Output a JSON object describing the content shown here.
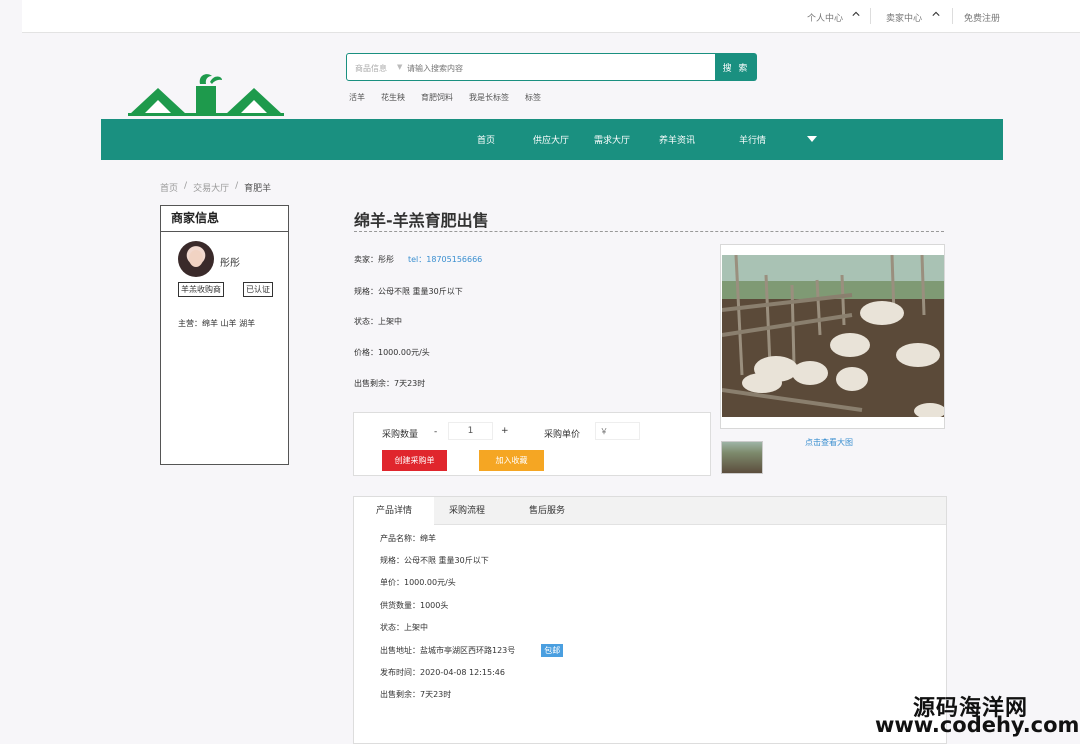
{
  "topbar": {
    "personal_center": "个人中心",
    "seller_center": "卖家中心",
    "register": "免费注册"
  },
  "search": {
    "category": "商品信息",
    "placeholder": "请输入搜索内容",
    "button": "搜 索",
    "hotwords": [
      "活羊",
      "花生秧",
      "育肥饲料",
      "我是长标签",
      "标签"
    ]
  },
  "nav": {
    "items": [
      "首页",
      "供应大厅",
      "需求大厅",
      "养羊资讯",
      "羊行情"
    ]
  },
  "breadcrumb": {
    "home": "首页",
    "sep": "/",
    "hall": "交易大厅",
    "current": "育肥羊"
  },
  "seller": {
    "header": "商家信息",
    "name": "彤彤",
    "tag1": "羊羔收购商",
    "tag2": "已认证",
    "main_business": "主营：绵羊 山羊 湖羊"
  },
  "product": {
    "title": "绵羊-羊羔育肥出售",
    "seller_label": "卖家：彤彤",
    "tel": "tel：18705156666",
    "spec": "规格：公母不限  重量30斤以下",
    "status": "状态：上架中",
    "price": "价格：1000.00元/头",
    "remaining": "出售剩余：7天23时",
    "view_big": "点击查看大图"
  },
  "purchase": {
    "qty_label": "采购数量",
    "minus": "-",
    "qty_value": "1",
    "plus": "+",
    "unit_price_label": "采购单价",
    "unit_price_placeholder": "￥",
    "create_order": "创建采购单",
    "add_favorite": "加入收藏"
  },
  "tabs": {
    "items": [
      "产品详情",
      "采购流程",
      "售后服务"
    ],
    "active": 0
  },
  "details": {
    "name": "产品名称：绵羊",
    "spec": "规格：公母不限  重量30斤以下",
    "unit_price": "单价：1000.00元/头",
    "supply_qty": "供货数量：1000头",
    "status": "状态：上架中",
    "address": "出售地址：盐城市亭湖区西环路123号",
    "badge": "包邮",
    "publish_time": "发布时间：2020-04-08 12:15:46",
    "remaining": "出售剩余：7天23时"
  },
  "watermark": {
    "line1": "源码海洋网",
    "line2": "www.codehy.com"
  },
  "colors": {
    "brand": "#1a9080",
    "danger": "#e0262d",
    "warning": "#f5a623",
    "link": "#3a8fd0"
  }
}
